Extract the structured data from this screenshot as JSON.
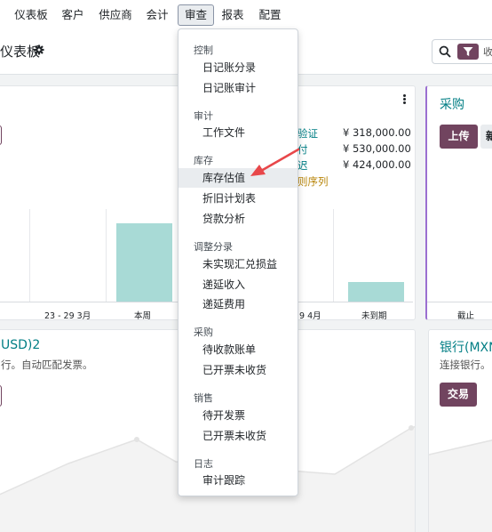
{
  "nav": {
    "items": [
      {
        "label": "仪表板"
      },
      {
        "label": "客户"
      },
      {
        "label": "供应商"
      },
      {
        "label": "会计"
      },
      {
        "label": "审查"
      },
      {
        "label": "报表"
      },
      {
        "label": "配置"
      }
    ]
  },
  "controlbar": {
    "title": "仪表板",
    "search_text": "收"
  },
  "card_main": {
    "x_ticks": [
      "23 - 29 3月",
      "本周",
      "9 4月",
      "未到期"
    ],
    "rows": [
      {
        "label": "验证",
        "amount": "¥ 318,000.00"
      },
      {
        "label": "付",
        "amount": "¥ 530,000.00"
      },
      {
        "label": "迟",
        "amount": "¥ 424,000.00"
      }
    ],
    "footnote": "则序列"
  },
  "card_purchase": {
    "title": "采购",
    "upload_label": "上传",
    "new_label": "新",
    "tick": "截止"
  },
  "card_bank_usd": {
    "title": "USD)2",
    "subtitle": "行。自动匹配发票。"
  },
  "card_bank_mxn": {
    "title": "银行(MXN",
    "subtitle": "连接银行。",
    "transactions_label": "交易"
  },
  "review_menu": {
    "sections": [
      {
        "header": "控制",
        "items": [
          "日记账分录",
          "日记账审计"
        ]
      },
      {
        "header": "审计",
        "items": [
          "工作文件"
        ]
      },
      {
        "header": "库存",
        "items": [
          "库存估值",
          "折旧计划表",
          "贷款分析"
        ]
      },
      {
        "header": "调整分录",
        "items": [
          "未实现汇兑损益",
          "递延收入",
          "递延费用"
        ]
      },
      {
        "header": "采购",
        "items": [
          "待收款账单",
          "已开票未收货"
        ]
      },
      {
        "header": "销售",
        "items": [
          "待开发票",
          "已开票未收货"
        ]
      },
      {
        "header": "日志",
        "items": [
          "审计跟踪"
        ]
      }
    ]
  },
  "colors": {
    "brand": "#71445f",
    "teal": "#017e84",
    "bar": "#a8dad6",
    "annotation_arrow": "#e8474a"
  }
}
